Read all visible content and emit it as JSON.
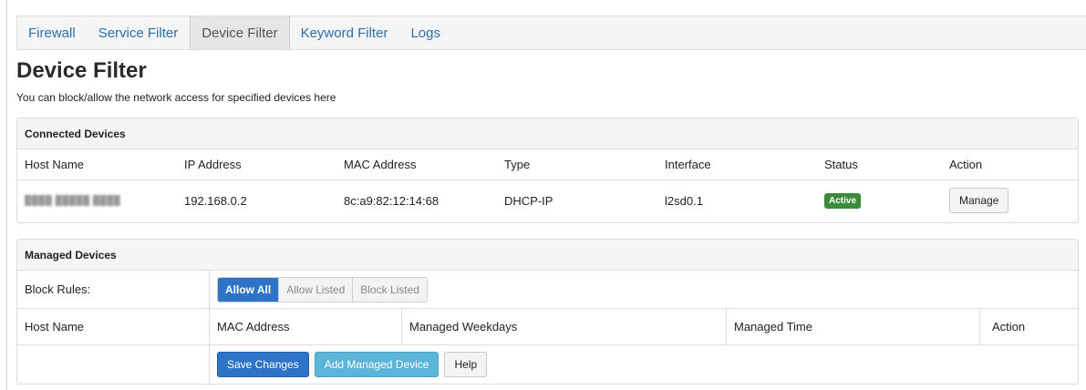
{
  "tabs": [
    {
      "label": "Firewall"
    },
    {
      "label": "Service Filter"
    },
    {
      "label": "Device Filter",
      "active": true
    },
    {
      "label": "Keyword Filter"
    },
    {
      "label": "Logs"
    }
  ],
  "page": {
    "title": "Device Filter",
    "description": "You can block/allow the network access for specified devices here"
  },
  "connected": {
    "heading": "Connected Devices",
    "columns": [
      "Host Name",
      "IP Address",
      "MAC Address",
      "Type",
      "Interface",
      "Status",
      "Action"
    ],
    "rows": [
      {
        "host": "████ █████ ████",
        "ip": "192.168.0.2",
        "mac": "8c:a9:82:12:14:68",
        "type": "DHCP-IP",
        "interface": "l2sd0.1",
        "status": "Active",
        "action": "Manage"
      }
    ]
  },
  "managed": {
    "heading": "Managed Devices",
    "block_rules_label": "Block Rules:",
    "block_rules_options": [
      "Allow All",
      "Allow Listed",
      "Block Listed"
    ],
    "block_rules_selected": "Allow All",
    "columns": [
      "Host Name",
      "MAC Address",
      "Managed Weekdays",
      "Managed Time",
      "Action"
    ],
    "buttons": {
      "save": "Save Changes",
      "add": "Add Managed Device",
      "help": "Help"
    }
  },
  "colors": {
    "link": "#2a6fb0",
    "primary": "#2d74c8",
    "info": "#5bb5d8",
    "active_badge": "#3c8a3c"
  }
}
